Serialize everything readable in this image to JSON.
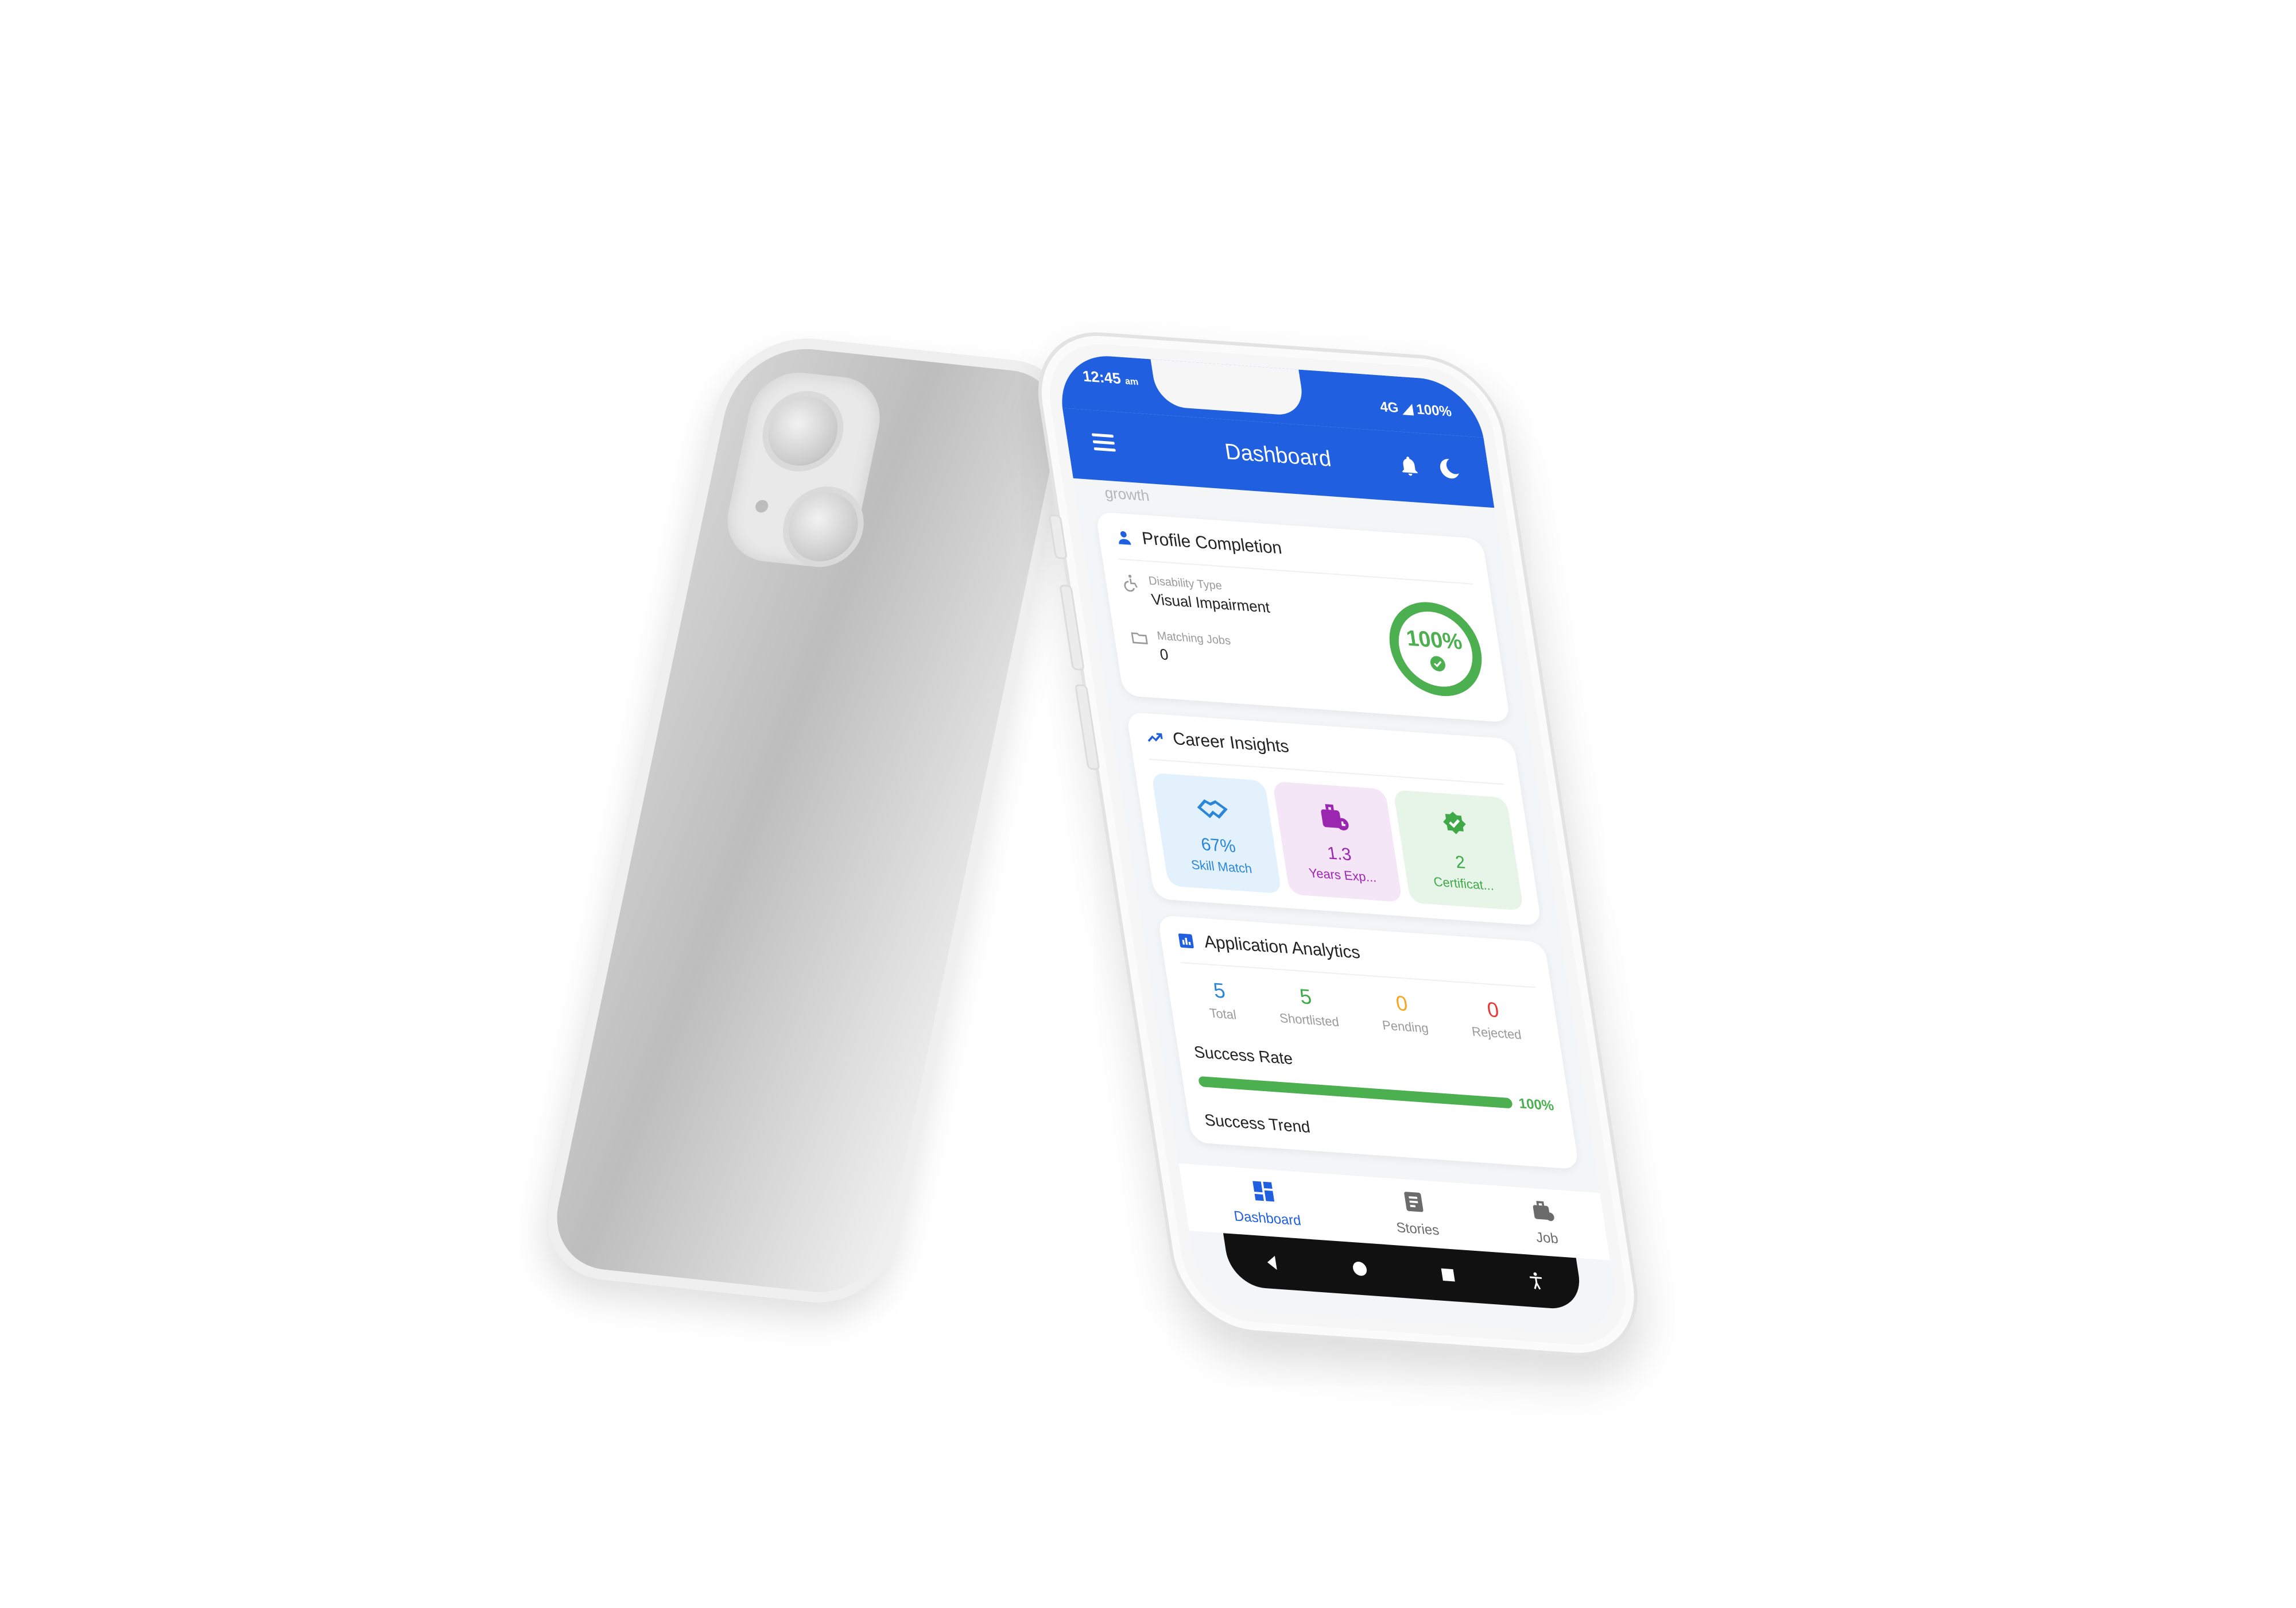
{
  "status": {
    "time": "12:45",
    "time_suffix": "am",
    "right": "4G ◢ 100%"
  },
  "appbar": {
    "title": "Dashboard"
  },
  "scroll_hint": "growth",
  "profile": {
    "title": "Profile Completion",
    "disability_label": "Disability Type",
    "disability_value": "Visual Impairment",
    "jobs_label": "Matching Jobs",
    "jobs_value": "0",
    "completion_text": "100%",
    "completion_fraction": 1.0,
    "ring_color": "#4caf50"
  },
  "insights": {
    "title": "Career Insights",
    "items": [
      {
        "value": "67%",
        "label": "Skill Match",
        "icon": "handshake-icon",
        "color": "#2a86d9",
        "bg": "#e3f1fc"
      },
      {
        "value": "1.3",
        "label": "Years Exp...",
        "icon": "briefcase-clock-icon",
        "color": "#9b27b0",
        "bg": "#f4e5f7"
      },
      {
        "value": "2",
        "label": "Certificat...",
        "icon": "verified-badge-icon",
        "color": "#3fa847",
        "bg": "#e7f5e8"
      }
    ]
  },
  "analytics": {
    "title": "Application Analytics",
    "stats": [
      {
        "value": "5",
        "label": "Total",
        "color": "#2a86d9"
      },
      {
        "value": "5",
        "label": "Shortlisted",
        "color": "#3fa847"
      },
      {
        "value": "0",
        "label": "Pending",
        "color": "#f5a623"
      },
      {
        "value": "0",
        "label": "Rejected",
        "color": "#e53935"
      }
    ],
    "success_rate_label": "Success Rate",
    "success_rate_text": "100%",
    "success_rate_fraction": 1.0,
    "trend_label": "Success Trend"
  },
  "nav": {
    "items": [
      {
        "label": "Dashboard",
        "icon": "dashboard-icon",
        "active": true
      },
      {
        "label": "Stories",
        "icon": "stories-icon",
        "active": false
      },
      {
        "label": "Job",
        "icon": "job-icon",
        "active": false
      }
    ]
  },
  "colors": {
    "primary": "#1f5fe0",
    "success": "#4caf50",
    "inactive": "#6b6b6b"
  }
}
